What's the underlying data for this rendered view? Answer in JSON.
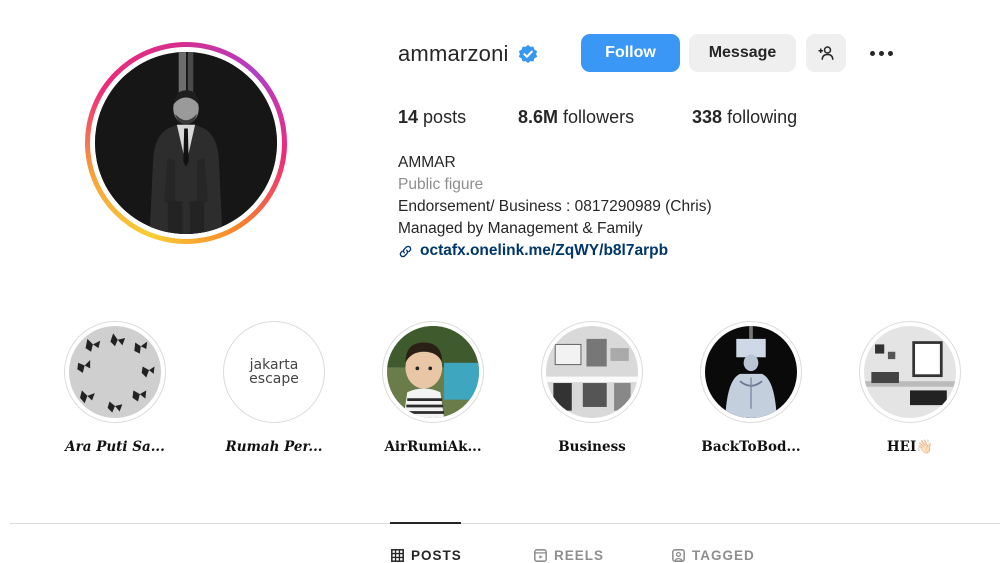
{
  "profile": {
    "username": "ammarzoni",
    "verified_icon": "verified-badge-icon",
    "buttons": {
      "follow": "Follow",
      "message": "Message",
      "add_user_icon": "add-user-icon",
      "more_icon": "more-options-icon"
    },
    "stats": {
      "posts_count": "14",
      "posts_label": "posts",
      "followers_count": "8.6M",
      "followers_label": "followers",
      "following_count": "338",
      "following_label": "following"
    },
    "bio": {
      "name": "AMMAR",
      "category": "Public figure",
      "line1": "Endorsement/ Business : 0817290989 (Chris)",
      "line2": "Managed by Management & Family",
      "link": "octafx.onelink.me/ZqWY/b8l7arpb"
    }
  },
  "highlights": [
    {
      "label": "Ara Puti Sa..."
    },
    {
      "label": "Rumah Per...",
      "logo_text_1": "jakarta",
      "logo_text_2": "escape"
    },
    {
      "label": "AirRumiAk..."
    },
    {
      "label": "Business"
    },
    {
      "label": "BackToBod..."
    },
    {
      "label": "HEI👋🏻"
    }
  ],
  "tabs": [
    {
      "label": "POSTS",
      "icon": "grid-icon",
      "active": true
    },
    {
      "label": "REELS",
      "icon": "reels-icon",
      "active": false
    },
    {
      "label": "TAGGED",
      "icon": "tagged-icon",
      "active": false
    }
  ],
  "colors": {
    "follow_button": "#3b97f5",
    "secondary_button": "#efefef",
    "link": "#00376b",
    "muted_text": "#8e8e8e",
    "verified": "#3897f0"
  }
}
